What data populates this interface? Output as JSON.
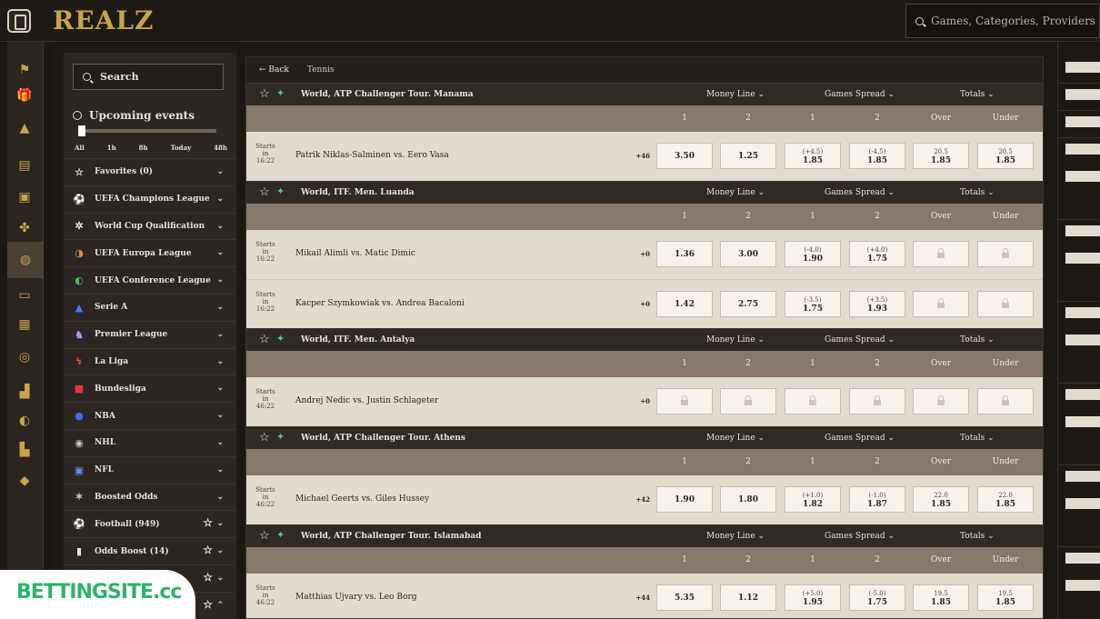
{
  "brand": "REALZ",
  "top_search": {
    "placeholder": "Games, Categories, Providers"
  },
  "left": {
    "search_label": "Search",
    "upcoming_title": "Upcoming events",
    "time_ticks": [
      "All",
      "1h",
      "8h",
      "Today",
      "48h"
    ],
    "menu": [
      {
        "label": "Favorites (0)",
        "icon": "☆",
        "icon_name": "star-icon",
        "color": "#e8e2d6"
      },
      {
        "label": "UEFA Champions League",
        "icon": "⚽",
        "icon_name": "champions-league-icon",
        "color": "#9fb4ff"
      },
      {
        "label": "World Cup Qualification",
        "icon": "✲",
        "icon_name": "world-cup-icon",
        "color": "#e8e2d6"
      },
      {
        "label": "UEFA Europa League",
        "icon": "◑",
        "icon_name": "europa-league-icon",
        "color": "#f08a2c"
      },
      {
        "label": "UEFA Conference League",
        "icon": "◐",
        "icon_name": "conference-league-icon",
        "color": "#39c46a"
      },
      {
        "label": "Serie A",
        "icon": "▲",
        "icon_name": "serie-a-icon",
        "color": "#3d7dff"
      },
      {
        "label": "Premier League",
        "icon": "♞",
        "icon_name": "premier-league-icon",
        "color": "#b08cff"
      },
      {
        "label": "La Liga",
        "icon": "↯",
        "icon_name": "la-liga-icon",
        "color": "#ff4a3a"
      },
      {
        "label": "Bundesliga",
        "icon": "■",
        "icon_name": "bundesliga-icon",
        "color": "#e8333a"
      },
      {
        "label": "NBA",
        "icon": "●",
        "icon_name": "nba-icon",
        "color": "#3d6bff"
      },
      {
        "label": "NHL",
        "icon": "◉",
        "icon_name": "nhl-icon",
        "color": "#cfc6b8"
      },
      {
        "label": "NFL",
        "icon": "▣",
        "icon_name": "nfl-icon",
        "color": "#6f8dff"
      },
      {
        "label": "Boosted Odds",
        "icon": "✶",
        "icon_name": "boosted-odds-icon",
        "color": "#cfc6b8"
      },
      {
        "label": "Football (949)",
        "icon": "⚽",
        "icon_name": "football-icon",
        "color": "#e8e2d6",
        "fav": true
      },
      {
        "label": "Odds Boost (14)",
        "icon": "▮",
        "icon_name": "odds-boost-icon",
        "color": "#e8e2d6",
        "fav": true
      },
      {
        "label": "",
        "icon": "",
        "icon_name": "blank-icon",
        "color": "#e8e2d6",
        "fav": true
      },
      {
        "label": "",
        "icon": "",
        "icon_name": "blank-icon",
        "color": "#e8e2d6",
        "fav": true,
        "up": true
      }
    ]
  },
  "main": {
    "back_label": "Back",
    "sport": "Tennis",
    "market_labels": [
      "Money Line",
      "Games Spread",
      "Totals"
    ],
    "col_labels": [
      "1",
      "2",
      "1",
      "2",
      "Over",
      "Under"
    ],
    "starts_label": "Starts",
    "in_label": "in",
    "leagues": [
      {
        "name": "World, ATP Challenger Tour. Manama",
        "matches": [
          {
            "time": "16:22",
            "teams": "Patrik Niklas-Salminen  vs.  Eero Vasa",
            "more": "+46",
            "odds": [
              {
                "v": "3.50"
              },
              {
                "v": "1.25"
              },
              {
                "h": "(+4.5)",
                "v": "1.85"
              },
              {
                "h": "(-4.5)",
                "v": "1.85"
              },
              {
                "h": "20.5",
                "v": "1.85"
              },
              {
                "h": "20.5",
                "v": "1.85"
              }
            ]
          }
        ]
      },
      {
        "name": "World, ITF. Men. Luanda",
        "matches": [
          {
            "time": "16:22",
            "teams": "Mikail Alimli  vs.  Matic Dimic",
            "more": "+0",
            "odds": [
              {
                "v": "1.36"
              },
              {
                "v": "3.00"
              },
              {
                "h": "(-4.0)",
                "v": "1.90"
              },
              {
                "h": "(+4.0)",
                "v": "1.75"
              },
              {
                "lock": true
              },
              {
                "lock": true
              }
            ]
          },
          {
            "time": "16:22",
            "teams": "Kacper Szymkowiak  vs.  Andrea Bacaloni",
            "more": "+0",
            "odds": [
              {
                "v": "1.42"
              },
              {
                "v": "2.75"
              },
              {
                "h": "(-3.5)",
                "v": "1.75"
              },
              {
                "h": "(+3.5)",
                "v": "1.93"
              },
              {
                "lock": true
              },
              {
                "lock": true
              }
            ]
          }
        ]
      },
      {
        "name": "World, ITF. Men. Antalya",
        "matches": [
          {
            "time": "46:22",
            "teams": "Andrej Nedic  vs.  Justin Schlageter",
            "more": "+0",
            "odds": [
              {
                "lock": true
              },
              {
                "lock": true
              },
              {
                "lock": true
              },
              {
                "lock": true
              },
              {
                "lock": true
              },
              {
                "lock": true
              }
            ]
          }
        ]
      },
      {
        "name": "World, ATP Challenger Tour. Athens",
        "matches": [
          {
            "time": "46:22",
            "teams": "Michael Geerts  vs.  Giles Hussey",
            "more": "+42",
            "odds": [
              {
                "v": "1.90"
              },
              {
                "v": "1.80"
              },
              {
                "h": "(+1.0)",
                "v": "1.82"
              },
              {
                "h": "(-1.0)",
                "v": "1.87"
              },
              {
                "h": "22.0",
                "v": "1.85"
              },
              {
                "h": "22.0",
                "v": "1.85"
              }
            ]
          }
        ]
      },
      {
        "name": "World, ATP Challenger Tour. Islamabad",
        "matches": [
          {
            "time": "46:22",
            "teams": "Matthias Ujvary  vs.  Leo Borg",
            "more": "+44",
            "odds": [
              {
                "v": "5.35"
              },
              {
                "v": "1.12"
              },
              {
                "h": "(+5.0)",
                "v": "1.95"
              },
              {
                "h": "(-5.0)",
                "v": "1.75"
              },
              {
                "h": "19.5",
                "v": "1.85"
              },
              {
                "h": "19.5",
                "v": "1.85"
              }
            ]
          }
        ]
      }
    ]
  },
  "rail_icons": [
    "sports-icon",
    "gift-icon",
    "pyramid-icon",
    "slot-icon",
    "cards-icon",
    "clover-icon",
    "basketball-icon",
    "live-icon",
    "table-icon",
    "wheel-icon",
    "casino-icon",
    "chip-icon",
    "shop-icon",
    "diamond-icon"
  ],
  "watermark": "BETTINGSITE.cc"
}
